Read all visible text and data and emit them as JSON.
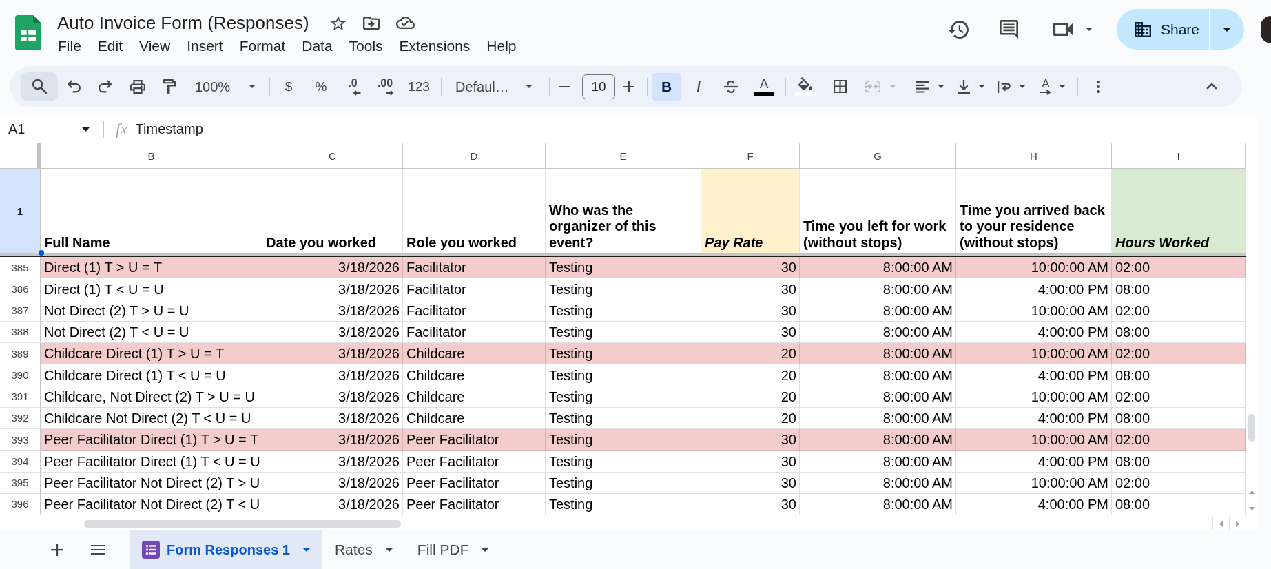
{
  "document": {
    "title": "Auto Invoice Form (Responses)",
    "starred": false
  },
  "menu": [
    "File",
    "Edit",
    "View",
    "Insert",
    "Format",
    "Data",
    "Tools",
    "Extensions",
    "Help"
  ],
  "share": {
    "label": "Share"
  },
  "toolbar": {
    "zoom": "100%",
    "number_formats": [
      {
        "label": "$",
        "kind": "plain"
      },
      {
        "label": "%",
        "kind": "plain"
      },
      {
        "label": ".0",
        "kind": "decrease"
      },
      {
        "label": ".00",
        "kind": "increase"
      },
      {
        "label": "123",
        "kind": "plain"
      }
    ],
    "font": "Defaul…",
    "font_size": "10",
    "text_styles": [
      {
        "label": "B",
        "kind": "bold",
        "selected": true
      },
      {
        "label": "I",
        "kind": "italic",
        "selected": false
      }
    ],
    "text_color": {
      "label": "A"
    },
    "merge": {
      "disabled": true
    },
    "rotation": {
      "label": "A"
    }
  },
  "formula_bar": {
    "cell": "A1",
    "function_symbol": "fx",
    "value": "Timestamp"
  },
  "sheet": {
    "columns": [
      {
        "letter": "B",
        "kind": "text",
        "selected": false
      },
      {
        "letter": "C",
        "kind": "number",
        "selected": false
      },
      {
        "letter": "D",
        "kind": "text",
        "selected": false
      },
      {
        "letter": "E",
        "kind": "text",
        "selected": false
      },
      {
        "letter": "F",
        "kind": "number",
        "selected": false
      },
      {
        "letter": "G",
        "kind": "number",
        "selected": false
      },
      {
        "letter": "H",
        "kind": "number",
        "selected": false
      },
      {
        "letter": "I",
        "kind": "text",
        "selected": false
      }
    ],
    "header_row": {
      "number": "1",
      "selected": true,
      "cells": [
        {
          "text": "Full Name",
          "italic": false,
          "color": "#ffffff"
        },
        {
          "text": "Date you worked",
          "italic": false,
          "color": "#ffffff"
        },
        {
          "text": "Role you worked",
          "italic": false,
          "color": "#ffffff"
        },
        {
          "text": "Who was the organizer of this event?",
          "italic": false,
          "color": "#ffffff"
        },
        {
          "text": "Pay Rate",
          "italic": true,
          "color": "#fff2cc"
        },
        {
          "text": "Time you left for work (without stops)",
          "italic": false,
          "color": "#ffffff"
        },
        {
          "text": "Time you arrived back to your residence (without stops)",
          "italic": false,
          "color": "#ffffff"
        },
        {
          "text": "Hours Worked",
          "italic": true,
          "color": "#d9ead3"
        }
      ]
    },
    "rows": [
      {
        "number": "385",
        "selected": false,
        "color": "#f4cccc",
        "cells": [
          "Direct (1) T > U = T",
          "3/18/2026",
          "Facilitator",
          "Testing",
          "30",
          "8:00:00 AM",
          "10:00:00 AM",
          "02:00"
        ]
      },
      {
        "number": "386",
        "selected": false,
        "color": "#ffffff",
        "cells": [
          "Direct (1) T < U = U",
          "3/18/2026",
          "Facilitator",
          "Testing",
          "30",
          "8:00:00 AM",
          "4:00:00 PM",
          "08:00"
        ]
      },
      {
        "number": "387",
        "selected": false,
        "color": "#ffffff",
        "cells": [
          "Not Direct (2) T > U = U",
          "3/18/2026",
          "Facilitator",
          "Testing",
          "30",
          "8:00:00 AM",
          "10:00:00 AM",
          "02:00"
        ]
      },
      {
        "number": "388",
        "selected": false,
        "color": "#ffffff",
        "cells": [
          "Not Direct (2) T < U = U",
          "3/18/2026",
          "Facilitator",
          "Testing",
          "30",
          "8:00:00 AM",
          "4:00:00 PM",
          "08:00"
        ]
      },
      {
        "number": "389",
        "selected": false,
        "color": "#f4cccc",
        "cells": [
          "Childcare Direct (1) T > U = T",
          "3/18/2026",
          "Childcare",
          "Testing",
          "20",
          "8:00:00 AM",
          "10:00:00 AM",
          "02:00"
        ]
      },
      {
        "number": "390",
        "selected": false,
        "color": "#ffffff",
        "cells": [
          "Childcare Direct (1) T < U = U",
          "3/18/2026",
          "Childcare",
          "Testing",
          "20",
          "8:00:00 AM",
          "4:00:00 PM",
          "08:00"
        ]
      },
      {
        "number": "391",
        "selected": false,
        "color": "#ffffff",
        "cells": [
          "Childcare, Not Direct (2) T > U = U",
          "3/18/2026",
          "Childcare",
          "Testing",
          "20",
          "8:00:00 AM",
          "10:00:00 AM",
          "02:00"
        ]
      },
      {
        "number": "392",
        "selected": false,
        "color": "#ffffff",
        "cells": [
          "Childcare Not Direct (2) T < U = U",
          "3/18/2026",
          "Childcare",
          "Testing",
          "20",
          "8:00:00 AM",
          "4:00:00 PM",
          "08:00"
        ]
      },
      {
        "number": "393",
        "selected": false,
        "color": "#f4cccc",
        "cells": [
          "Peer Facilitator Direct (1) T > U = T",
          "3/18/2026",
          "Peer Facilitator",
          "Testing",
          "30",
          "8:00:00 AM",
          "10:00:00 AM",
          "02:00"
        ]
      },
      {
        "number": "394",
        "selected": false,
        "color": "#ffffff",
        "cells": [
          "Peer Facilitator Direct (1) T < U = U",
          "3/18/2026",
          "Peer Facilitator",
          "Testing",
          "30",
          "8:00:00 AM",
          "4:00:00 PM",
          "08:00"
        ]
      },
      {
        "number": "395",
        "selected": false,
        "color": "#ffffff",
        "cells": [
          "Peer Facilitator Not Direct (2) T > U",
          "3/18/2026",
          "Peer Facilitator",
          "Testing",
          "30",
          "8:00:00 AM",
          "10:00:00 AM",
          "02:00"
        ]
      },
      {
        "number": "396",
        "selected": false,
        "color": "#ffffff",
        "cells": [
          "Peer Facilitator Not Direct (2) T < U",
          "3/18/2026",
          "Peer Facilitator",
          "Testing",
          "30",
          "8:00:00 AM",
          "4:00:00 PM",
          "08:00"
        ]
      }
    ]
  },
  "tabs": [
    {
      "label": "Form Responses 1",
      "selected": true,
      "form_linked": true
    },
    {
      "label": "Rates",
      "selected": false,
      "form_linked": false
    },
    {
      "label": "Fill PDF",
      "selected": false,
      "form_linked": false
    }
  ]
}
